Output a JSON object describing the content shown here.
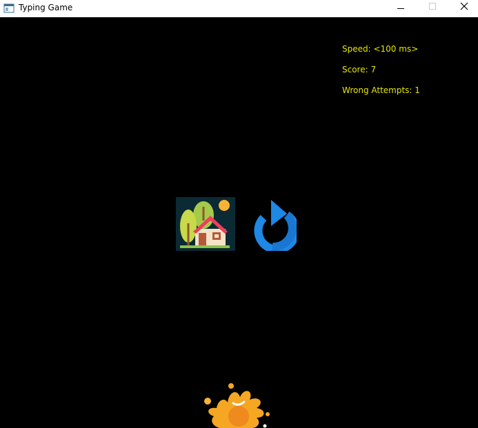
{
  "window": {
    "title": "Typing Game"
  },
  "hud": {
    "speed": "Speed: <100 ms>",
    "score": "Score: 7",
    "wrong_attempts": "Wrong Attempts: 1",
    "text_color": "#e6e600"
  },
  "buttons": {
    "home_icon": "house-icon",
    "restart_icon": "restart-icon"
  },
  "decor": {
    "splash_icon": "paint-splash-icon"
  },
  "colors": {
    "background": "#000000",
    "titlebar": "#ffffff",
    "restart_blue": "#1e88e5",
    "splash_orange": "#f5a623"
  }
}
